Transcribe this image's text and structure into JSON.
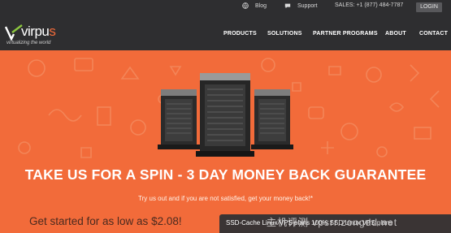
{
  "topbar": {
    "blog_label": "Blog",
    "support_label": "Support",
    "sales_label": "SALES: +1 (877) 484-7787",
    "login_label": "LOGIN"
  },
  "logo": {
    "name_prefix": "virpu",
    "name_suffix": "s",
    "tagline": "virtualizing the world"
  },
  "nav": {
    "items": [
      "PRODUCTS",
      "SOLUTIONS",
      "PARTNER PROGRAMS",
      "ABOUT",
      "CONTACT"
    ]
  },
  "hero": {
    "headline": "TAKE US FOR A SPIN - 3 DAY MONEY BACK GUARANTEE",
    "subline": "Try us out and if you are not satisfied, get your money back!*",
    "price_prefix": "Get started for as low as ",
    "price_value": "$2.08!"
  },
  "promo": {
    "text1": "SSD-Cache Linux VPS plans",
    "text2": "100% SSD Linux VPS plans",
    "watermark": "主机评测 vpsrr.zongdd.net"
  },
  "colors": {
    "header_bg": "#2e2e30",
    "accent": "#f26b3a",
    "promo_bg": "#3a3434"
  }
}
